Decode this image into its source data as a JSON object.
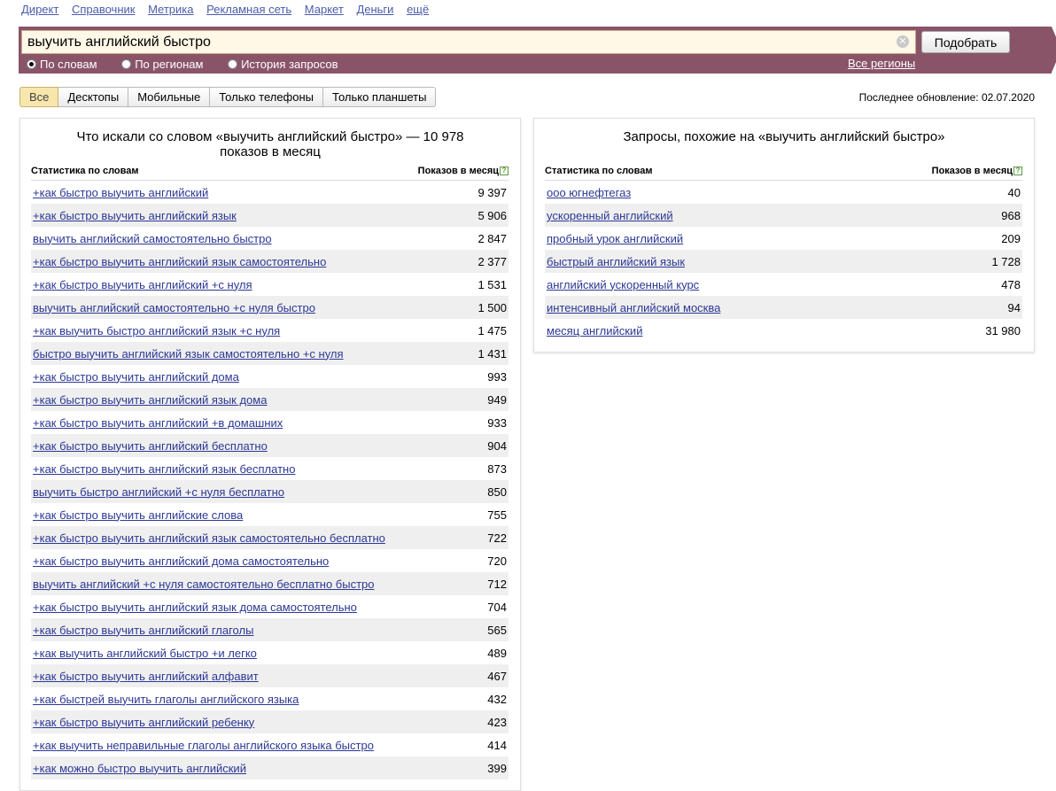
{
  "nav": {
    "items": [
      "Директ",
      "Справочник",
      "Метрика",
      "Рекламная сеть",
      "Маркет",
      "Деньги",
      "ещё"
    ]
  },
  "search": {
    "value": "выучить английский быстро",
    "submit_label": "Подобрать",
    "modes": [
      "По словам",
      "По регионам",
      "История запросов"
    ],
    "selected_mode": "По словам",
    "regions_label": "Все регионы",
    "bar_color": "#8a5468"
  },
  "devices": {
    "tabs": [
      "Все",
      "Десктопы",
      "Мобильные",
      "Только телефоны",
      "Только планшеты"
    ],
    "active": "Все"
  },
  "updated": "Последнее обновление: 02.07.2020",
  "left_panel": {
    "title": "Что искали со словом «выучить английский быстро» — 10 978 показов в месяц",
    "col_phrase": "Статистика по словам",
    "col_count": "Показов в месяц",
    "rows": [
      {
        "phrase": "+как быстро выучить английский",
        "count": "9 397"
      },
      {
        "phrase": "+как быстро выучить английский язык",
        "count": "5 906"
      },
      {
        "phrase": "выучить английский самостоятельно быстро",
        "count": "2 847"
      },
      {
        "phrase": "+как быстро выучить английский язык самостоятельно",
        "count": "2 377"
      },
      {
        "phrase": "+как быстро выучить английский +с нуля",
        "count": "1 531"
      },
      {
        "phrase": "выучить английский самостоятельно +с нуля быстро",
        "count": "1 500"
      },
      {
        "phrase": "+как выучить быстро английский язык +с нуля",
        "count": "1 475"
      },
      {
        "phrase": "быстро выучить английский язык самостоятельно +с нуля",
        "count": "1 431"
      },
      {
        "phrase": "+как быстро выучить английский дома",
        "count": "993"
      },
      {
        "phrase": "+как быстро выучить английский язык дома",
        "count": "949"
      },
      {
        "phrase": "+как быстро выучить английский +в домашних",
        "count": "933"
      },
      {
        "phrase": "+как быстро выучить английский бесплатно",
        "count": "904"
      },
      {
        "phrase": "+как быстро выучить английский язык бесплатно",
        "count": "873"
      },
      {
        "phrase": "выучить быстро английский +с нуля бесплатно",
        "count": "850"
      },
      {
        "phrase": "+как быстро выучить английские слова",
        "count": "755"
      },
      {
        "phrase": "+как быстро выучить английский язык самостоятельно бесплатно",
        "count": "722"
      },
      {
        "phrase": "+как быстро выучить английский дома самостоятельно",
        "count": "720"
      },
      {
        "phrase": "выучить английский +с нуля самостоятельно бесплатно быстро",
        "count": "712"
      },
      {
        "phrase": "+как быстро выучить английский язык дома самостоятельно",
        "count": "704"
      },
      {
        "phrase": "+как быстро выучить английский глаголы",
        "count": "565"
      },
      {
        "phrase": "+как выучить английский быстро +и легко",
        "count": "489"
      },
      {
        "phrase": "+как быстро выучить английский алфавит",
        "count": "467"
      },
      {
        "phrase": "+как быстрей выучить глаголы английского языка",
        "count": "432"
      },
      {
        "phrase": "+как быстро выучить английский ребенку",
        "count": "423"
      },
      {
        "phrase": "+как выучить неправильные глаголы английского языка быстро",
        "count": "414"
      },
      {
        "phrase": "+как можно быстро выучить английский",
        "count": "399"
      }
    ]
  },
  "right_panel": {
    "title": "Запросы, похожие на «выучить английский быстро»",
    "col_phrase": "Статистика по словам",
    "col_count": "Показов в месяц",
    "rows": [
      {
        "phrase": "ооо югнефтегаз",
        "count": "40"
      },
      {
        "phrase": "ускоренный английский",
        "count": "968"
      },
      {
        "phrase": "пробный урок английский",
        "count": "209"
      },
      {
        "phrase": "быстрый английский язык",
        "count": "1 728"
      },
      {
        "phrase": "английский ускоренный курс",
        "count": "478"
      },
      {
        "phrase": "интенсивный английский москва",
        "count": "94"
      },
      {
        "phrase": "месяц английский",
        "count": "31 980"
      }
    ]
  }
}
